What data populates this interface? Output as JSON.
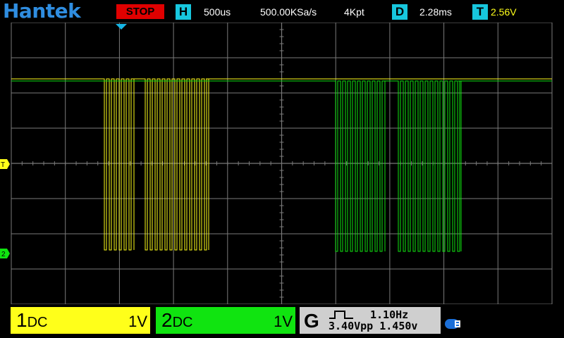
{
  "status_bar": {
    "brand": "Hantek",
    "run_state": "STOP",
    "horizontal": {
      "label": "H",
      "timebase": "500us",
      "sample_rate": "500.00KSa/s",
      "memory_depth": "4Kpt"
    },
    "delay": {
      "label": "D",
      "value": "2.28ms"
    },
    "trigger": {
      "label": "T",
      "level": "2.56V"
    }
  },
  "markers": {
    "ch1": "T",
    "ch2": "2"
  },
  "channels": [
    {
      "number": "1",
      "coupling": "DC",
      "scale": "1V",
      "color": "#ffff1a"
    },
    {
      "number": "2",
      "coupling": "DC",
      "scale": "1V",
      "color": "#10e410"
    }
  ],
  "generator": {
    "label": "G",
    "frequency": "1.10Hz",
    "amplitude": "3.40Vpp",
    "offset": "1.450v"
  },
  "colors": {
    "grid": "#7a7a7a",
    "trigger_marker": "#16b6e6",
    "ch1": "#ffff1a",
    "ch2": "#10e410"
  }
}
